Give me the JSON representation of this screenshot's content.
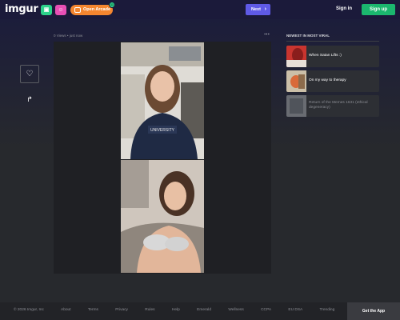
{
  "header": {
    "logo": "imgur",
    "arcade_label": "Open Arcade",
    "arcade_badge": "11",
    "next_label": "Next",
    "signin_label": "Sign in",
    "signup_label": "Sign up",
    "icons": [
      "gallery-icon",
      "emoji-icon",
      "gamepad-icon",
      "chevron-right-icon"
    ]
  },
  "post": {
    "meta": "0 Views • just now",
    "more": "⋯",
    "images": [
      "photo-1",
      "photo-2"
    ]
  },
  "actions": {
    "heart": "♡",
    "share": "↱"
  },
  "sidebar": {
    "title": "NEWEST IN MOST VIRAL",
    "items": [
      {
        "label": "When Satan Lifts :)"
      },
      {
        "label": "On my way to therapy"
      },
      {
        "label": "Return of the Memes 1631 (ethical degeneracy)"
      }
    ]
  },
  "footer": {
    "links": [
      "© 2026 Imgur, Inc",
      "About",
      "Terms",
      "Privacy",
      "Rules",
      "Help",
      "Emerald",
      "Wellness",
      "CCPA",
      "EU DSA",
      "Trending"
    ],
    "get_app": "Get the App"
  },
  "colors": {
    "header_bg": "#1b1a3a",
    "next_button": "#5f5ae6",
    "signup_button": "#1bb76e",
    "arcade_button": "#f5862f",
    "page_bg": "#27292d"
  }
}
